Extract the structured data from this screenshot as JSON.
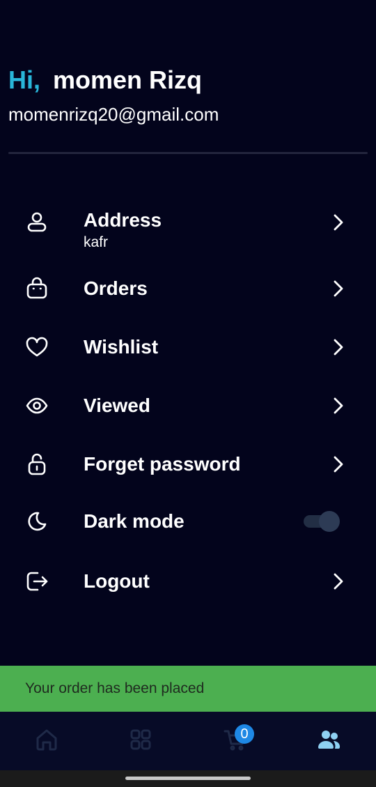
{
  "header": {
    "greeting": "Hi,",
    "user_name": "momen Rizq",
    "email": "momenrizq20@gmail.com"
  },
  "menu": {
    "items": [
      {
        "icon": "user-icon",
        "label": "Address",
        "sub": "kafr"
      },
      {
        "icon": "bag-icon",
        "label": "Orders"
      },
      {
        "icon": "heart-icon",
        "label": "Wishlist"
      },
      {
        "icon": "eye-icon",
        "label": "Viewed"
      },
      {
        "icon": "unlock-icon",
        "label": "Forget password"
      },
      {
        "icon": "moon-icon",
        "label": "Dark mode",
        "toggle_on": true
      },
      {
        "icon": "logout-icon",
        "label": "Logout"
      }
    ]
  },
  "snackbar": {
    "message": "Your order has been placed"
  },
  "bottom_nav": {
    "items": [
      {
        "icon": "home-icon",
        "active": false
      },
      {
        "icon": "grid-icon",
        "active": false
      },
      {
        "icon": "cart-icon",
        "active": false,
        "badge": "0"
      },
      {
        "icon": "profile-icon",
        "active": true
      }
    ]
  },
  "colors": {
    "background": "#03041c",
    "accent": "#29b6d9",
    "snackbar": "#4caf50",
    "badge": "#1e88e5",
    "nav_active": "#8fd1f2",
    "nav_inactive": "#1f2a48"
  }
}
